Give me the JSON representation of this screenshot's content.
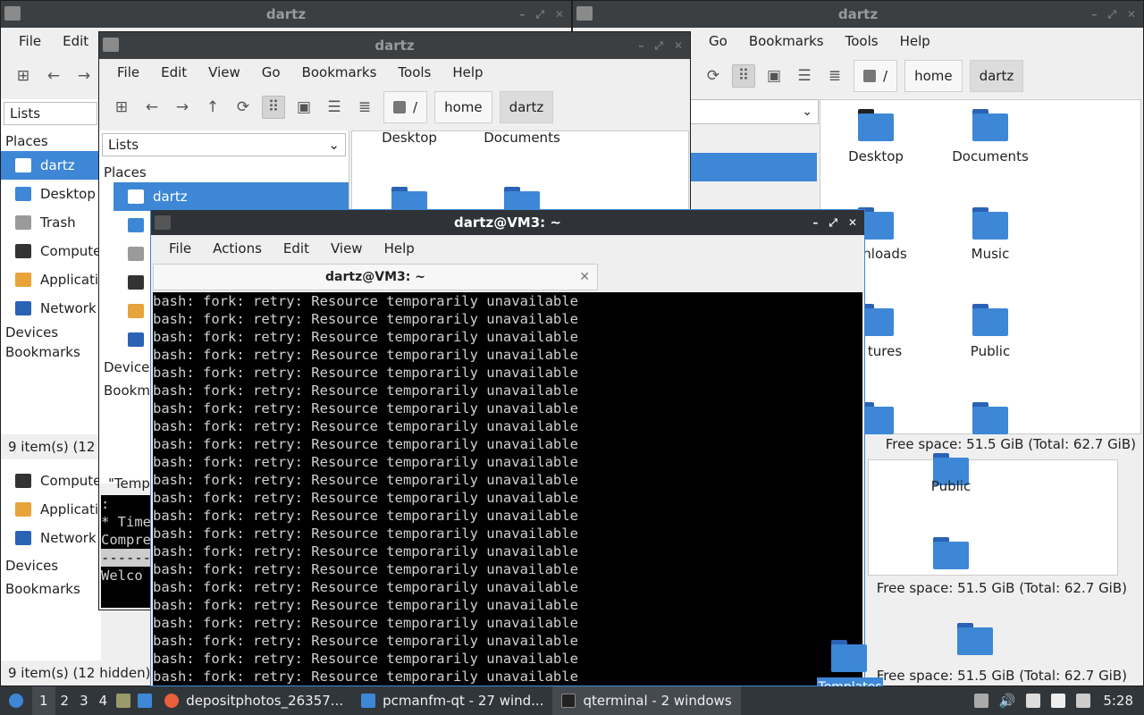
{
  "window_title": "dartz",
  "fm_menu": [
    "File",
    "Edit",
    "View",
    "Go",
    "Bookmarks",
    "Tools",
    "Help"
  ],
  "bg_left_menu": [
    "File",
    "Edit",
    "V"
  ],
  "bg_right_menu": [
    "Go",
    "Bookmarks",
    "Tools",
    "Help"
  ],
  "path": {
    "root": "/",
    "home": "home",
    "user": "dartz"
  },
  "side": {
    "combo": "Lists",
    "places": "Places",
    "items": [
      "dartz",
      "Desktop",
      "Trash",
      "Compute",
      "Applicatio",
      "Network"
    ],
    "devices": "Devices",
    "bookmarks": "Bookmarks"
  },
  "mid_side_items": [
    "dartz",
    "D",
    "T",
    "C",
    "A",
    "N"
  ],
  "status_left": "9 item(s) (12 hid",
  "status_left2": "9 item(s) (12 hidden)",
  "free_space": "Free space: 51.5 GiB (Total: 62.7 GiB)",
  "right_folders": [
    "Desktop",
    "Documents",
    "nloads",
    "Music",
    "tures",
    "Public"
  ],
  "mid_folders": [
    "Desktop",
    "Documents"
  ],
  "bottom_right_folders": [
    "Public"
  ],
  "desktop_icon": "Templates",
  "mid_partial_text": "\"Templ",
  "mid_term_lines": [
    ":",
    "* Time",
    "",
    "Compre",
    "------",
    "Welco"
  ],
  "terminal": {
    "title": "dartz@VM3: ~",
    "menu": [
      "File",
      "Actions",
      "Edit",
      "View",
      "Help"
    ],
    "tab": "dartz@VM3: ~",
    "line": "bash: fork: retry: Resource temporarily unavailable",
    "line_count": 22
  },
  "taskbar": {
    "workspaces": [
      "1",
      "2",
      "3",
      "4"
    ],
    "tasks": [
      "depositphotos_26357...",
      "pcmanfm-qt - 27 wind...",
      "qterminal - 2 windows"
    ],
    "clock": "5:28"
  }
}
